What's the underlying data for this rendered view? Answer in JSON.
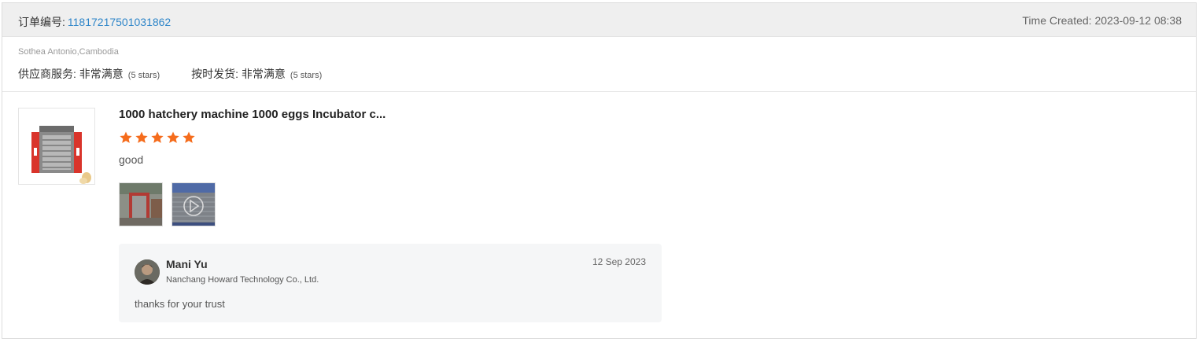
{
  "order": {
    "label": "订单编号:",
    "number": "11817217501031862",
    "time_created": "Time Created: 2023-09-12 08:38"
  },
  "buyer": {
    "name_location": "Sothea Antonio,Cambodia"
  },
  "ratings": [
    {
      "label": "供应商服务: 非常满意",
      "note": "(5 stars)"
    },
    {
      "label": "按时发货: 非常满意",
      "note": "(5 stars)"
    }
  ],
  "review": {
    "product_title": "1000 hatchery machine 1000 eggs Incubator c...",
    "stars": 5,
    "star_color": "#f56c1c",
    "comment": "good",
    "media": [
      {
        "type": "photo"
      },
      {
        "type": "video",
        "icon": "play-icon"
      }
    ]
  },
  "reply": {
    "name": "Mani Yu",
    "company": "Nanchang Howard Technology Co., Ltd.",
    "date": "12 Sep 2023",
    "text": "thanks for your trust"
  },
  "colors": {
    "link": "#2f86c9",
    "header_bg": "#efefef",
    "reply_bg": "#f5f6f7"
  }
}
